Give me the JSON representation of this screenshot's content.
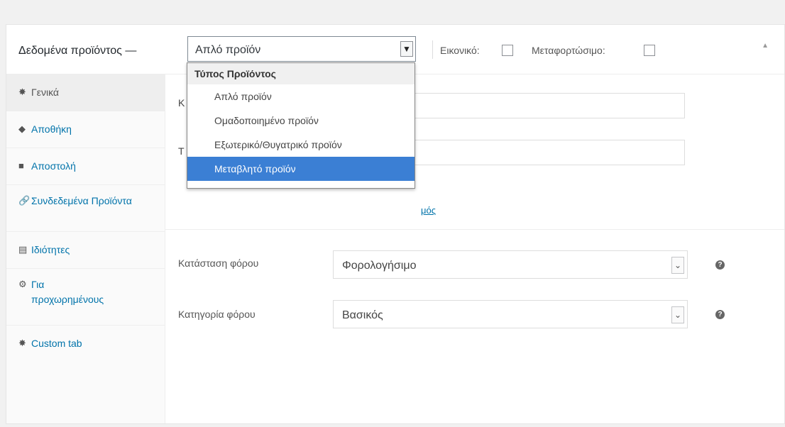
{
  "header": {
    "label": "Δεδομένα προϊόντος —",
    "type_select_value": "Απλό προϊόν",
    "virtual_label": "Εικονικό:",
    "downloadable_label": "Μεταφορτώσιμο:"
  },
  "dropdown": {
    "group_label": "Τύπος Προϊόντος",
    "options": [
      "Απλό προϊόν",
      "Ομαδοποιημένο προϊόν",
      "Εξωτερικό/Θυγατρικό προϊόν",
      "Μεταβλητό προϊόν"
    ],
    "selected_index": 3
  },
  "tabs": [
    {
      "icon": "wrench-icon",
      "label": "Γενικά"
    },
    {
      "icon": "tag-icon",
      "label": "Αποθήκη"
    },
    {
      "icon": "truck-icon",
      "label": "Αποστολή"
    },
    {
      "icon": "link-icon",
      "label": "Συνδεδεμένα Προϊόντα"
    },
    {
      "icon": "list-icon",
      "label": "Ιδιότητες"
    },
    {
      "icon": "gear-icon",
      "label": "Για προχωρημένους"
    },
    {
      "icon": "wrench-icon",
      "label": "Custom tab"
    }
  ],
  "general": {
    "partial_label_1": "Κ",
    "partial_label_2": "Τ",
    "link_fragment": "μός",
    "tax_status_label": "Κατάσταση φόρου",
    "tax_status_value": "Φορολογήσιμο",
    "tax_class_label": "Κατηγορία φόρου",
    "tax_class_value": "Βασικός",
    "help_glyph": "?"
  },
  "colors": {
    "link": "#0073aa",
    "selected_option": "#3b7fd4"
  }
}
